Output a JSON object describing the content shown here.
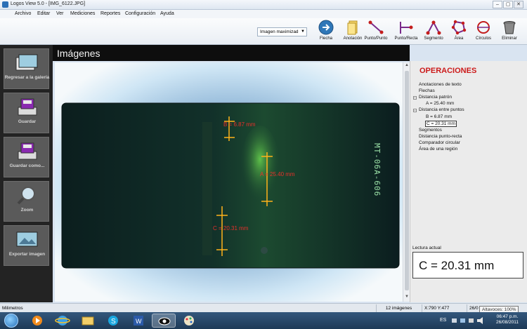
{
  "window": {
    "title": "Logos View 5.0 - [IMG_6122.JPG]"
  },
  "menu": [
    "Archivo",
    "Editar",
    "Ver",
    "Mediciones",
    "Reportes",
    "Configuración",
    "Ayuda"
  ],
  "toolbar": {
    "zoom_select_value": "Imagen maximizad",
    "tools": [
      {
        "label": "Flecha",
        "icon": "arrow-icon"
      },
      {
        "label": "Anotación",
        "icon": "note-icon"
      },
      {
        "label": "Punto/Punto",
        "icon": "point-point-icon"
      },
      {
        "label": "Punto/Recta",
        "icon": "point-line-icon"
      },
      {
        "label": "Segmento",
        "icon": "segment-icon"
      },
      {
        "label": "Área",
        "icon": "area-icon"
      },
      {
        "label": "Círculos",
        "icon": "circle-icon"
      },
      {
        "label": "Eliminar",
        "icon": "trash-icon"
      }
    ]
  },
  "sidebar": {
    "buttons": [
      {
        "label": "Regresar a la galería",
        "icon": "gallery-icon"
      },
      {
        "label": "Guardar",
        "icon": "save-icon"
      },
      {
        "label": "Guardar como...",
        "icon": "save-as-icon"
      },
      {
        "label": "Zoom",
        "icon": "magnifier-icon"
      },
      {
        "label": "Exportar imagen",
        "icon": "export-icon"
      }
    ]
  },
  "main": {
    "title": "Imágenes",
    "photo": {
      "stamp": "MT-06A-606",
      "measurements": [
        {
          "label": "B = 6.87 mm"
        },
        {
          "label": "A = 25.40 mm"
        },
        {
          "label": "C = 20.31 mm"
        }
      ]
    }
  },
  "operations": {
    "title": "OPERACIONES",
    "items": [
      {
        "label": "Anotaciones de texto",
        "level": 0
      },
      {
        "label": "Flechas",
        "level": 0
      },
      {
        "label": "Distancia patrón",
        "level": 0,
        "expandable": true
      },
      {
        "label": "A = 25.40 mm",
        "level": 1
      },
      {
        "label": "Distancia entre puntos",
        "level": 0,
        "expandable": true
      },
      {
        "label": "B = 6.87 mm",
        "level": 1
      },
      {
        "label": "C = 20.31 mm",
        "level": 1,
        "selected": true
      },
      {
        "label": "Segmentos",
        "level": 0
      },
      {
        "label": "Distancia punto-recta",
        "level": 0
      },
      {
        "label": "Comparador circular",
        "level": 0
      },
      {
        "label": "Área de una región",
        "level": 0
      }
    ],
    "reading_label": "Lectura actual",
    "reading_value": "C = 20.31 mm"
  },
  "statusbar": {
    "units": "Milimetros",
    "image_count": "12 imágenes",
    "coordinates": "X:790  Y:477",
    "date_partial": "26/0"
  },
  "tooltip": "Altavoces: 100%",
  "taskbar": {
    "language": "ES",
    "time": "06:47 p.m.",
    "date": "26/08/2011"
  },
  "colors": {
    "accent_red": "#cc1a1a",
    "measure_orange": "#ffb21a",
    "sidebar_bg": "#232323"
  }
}
